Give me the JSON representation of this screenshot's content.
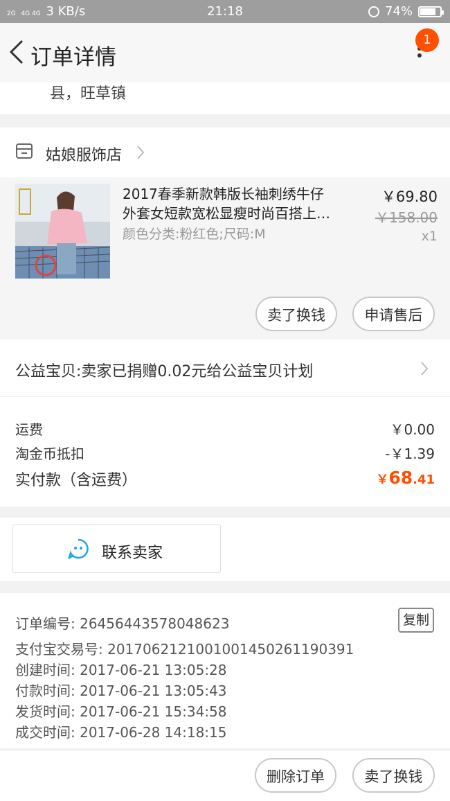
{
  "status_bar": {
    "network": "3 KB/s",
    "signal_labels": [
      "2G",
      "4G 4G"
    ],
    "time": "21:18",
    "battery": "74%",
    "battery_level": 0.74
  },
  "nav": {
    "title": "订单详情",
    "badge": "1"
  },
  "address": {
    "line": "县，旺草镇"
  },
  "shop": {
    "name": "姑娘服饰店"
  },
  "item": {
    "title_line1": "2017春季新款韩版长袖刺绣牛仔",
    "title_line2": "外套女短款宽松显瘦时尚百搭上…",
    "sku": "颜色分类:粉红色;尺码:M",
    "price": "￥69.80",
    "original_price": "￥158.00",
    "quantity": "x1",
    "actions": {
      "resell": "卖了换钱",
      "after_sale": "申请售后"
    }
  },
  "charity": {
    "text": "公益宝贝:卖家已捐赠0.02元给公益宝贝计划"
  },
  "fees": {
    "shipping_label": "运费",
    "shipping_value": "￥0.00",
    "coins_label": "淘金币抵扣",
    "coins_value": "-￥1.39",
    "total_label": "实付款（含运费）",
    "total_symbol": "￥",
    "total_int": "68",
    "total_dec": ".41"
  },
  "contact": {
    "label": "联系卖家"
  },
  "order_info": {
    "order_no": "订单编号: 26456443578048623",
    "alipay_no": "支付宝交易号: 20170621210010014502611903​91",
    "created": "创建时间: 2017-06-21 13:05:28",
    "paid": "付款时间: 2017-06-21 13:05:43",
    "shipped": "发货时间: 2017-06-21 15:34:58",
    "completed": "成交时间: 2017-06-28 14:18:15",
    "copy_label": "复制"
  },
  "footer": {
    "delete_label": "删除订单",
    "resell_label": "卖了换钱"
  },
  "colors": {
    "accent": "#ff5000",
    "statusbar": "#9e9e9e",
    "contact_icon": "#1ea4e9"
  }
}
